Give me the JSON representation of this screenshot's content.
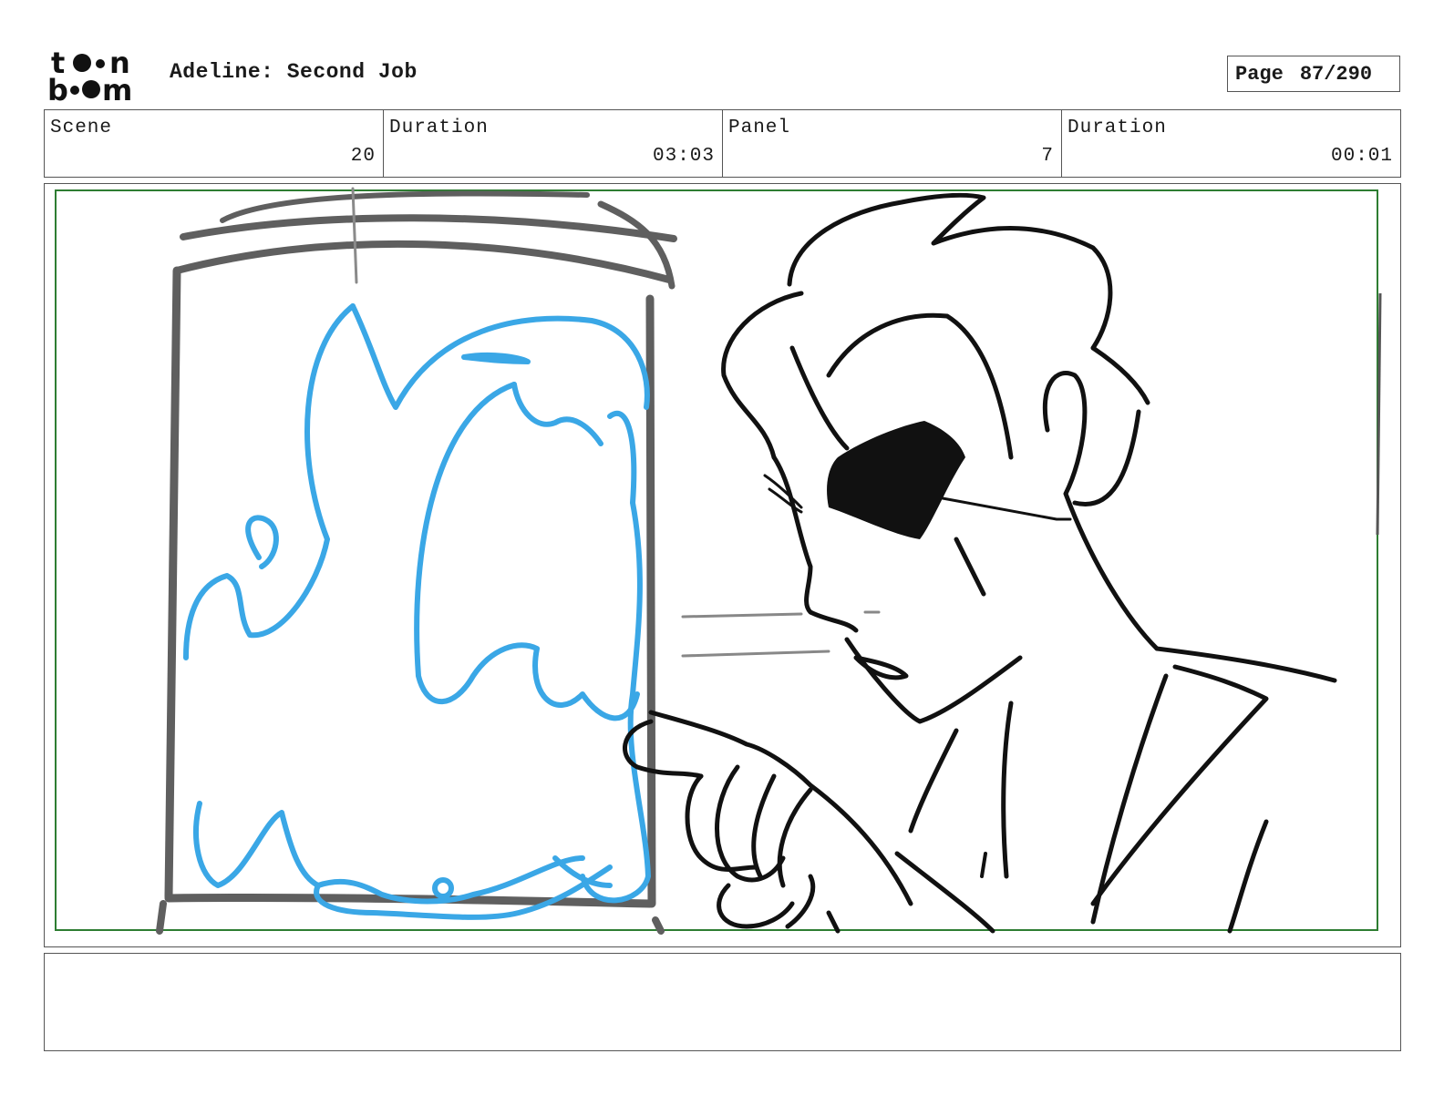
{
  "header": {
    "logo_alt": "toon boom",
    "project_title": "Adeline: Second Job",
    "page_label": "Page",
    "page_number": "87/290"
  },
  "info": {
    "scene_label": "Scene",
    "scene_value": "20",
    "scene_duration_label": "Duration",
    "scene_duration_value": "03:03",
    "panel_label": "Panel",
    "panel_value": "7",
    "panel_duration_label": "Duration",
    "panel_duration_value": "00:01"
  },
  "colors": {
    "safe_frame": "#2e7d32",
    "ink": "#111111",
    "tank": "#5f5f5f",
    "slime": "#3aa7e6"
  },
  "notes": {
    "text": ""
  }
}
